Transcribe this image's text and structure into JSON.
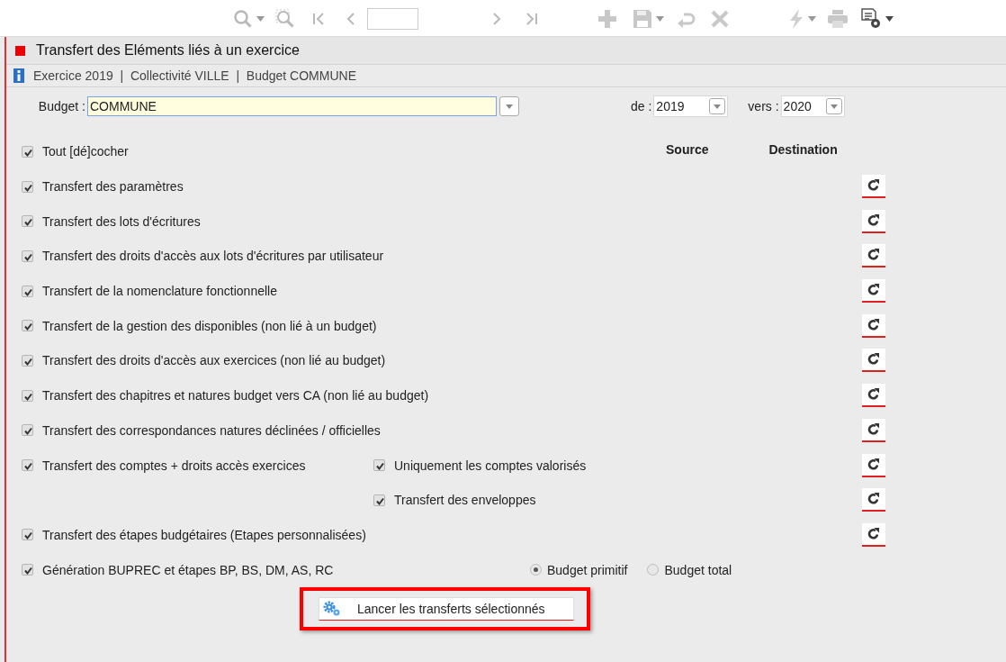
{
  "title": "Transfert des Eléments liés à un exercice",
  "context": "Exercice 2019  |  Collectivité VILLE  |  Budget COMMUNE",
  "budget": {
    "label": "Budget :",
    "value": "COMMUNE"
  },
  "year_from": {
    "label": "de :",
    "value": "2019"
  },
  "year_to": {
    "label": "vers :",
    "value": "2020"
  },
  "toggle_all": {
    "label": "Tout [dé]cocher",
    "checked": true
  },
  "columns": [
    "Source",
    "Destination"
  ],
  "rows": [
    {
      "kind": "transfer",
      "label": "Transfert des paramètres",
      "checked": true
    },
    {
      "kind": "transfer",
      "label": "Transfert des lots d'écritures",
      "checked": true
    },
    {
      "kind": "transfer",
      "label": "Transfert des droits d'accès aux lots d'écritures par utilisateur",
      "checked": true
    },
    {
      "kind": "transfer",
      "label": "Transfert de la nomenclature fonctionnelle",
      "checked": true
    },
    {
      "kind": "transfer",
      "label": "Transfert de la gestion des disponibles (non lié à un budget)",
      "checked": true
    },
    {
      "kind": "transfer",
      "label": "Transfert des droits d'accès aux exercices (non lié au budget)",
      "checked": true
    },
    {
      "kind": "transfer",
      "label": "Transfert des chapitres et natures budget vers CA (non lié au budget)",
      "checked": true
    },
    {
      "kind": "transfer",
      "label": "Transfert des correspondances natures déclinées / officielles",
      "checked": true
    },
    {
      "kind": "transfer",
      "label": "Transfert des comptes + droits accès exercices",
      "checked": true,
      "option": {
        "label": "Uniquement les comptes valorisés",
        "checked": true
      }
    },
    {
      "kind": "option",
      "label": "Transfert des enveloppes",
      "checked": true
    },
    {
      "kind": "transfer",
      "label": "Transfert des étapes budgétaires (Etapes personnalisées)",
      "checked": true
    },
    {
      "kind": "generation",
      "label": "Génération BUPREC et étapes BP, BS, DM, AS, RC",
      "checked": true,
      "choices": [
        {
          "label": "Budget primitif",
          "selected": true
        },
        {
          "label": "Budget total",
          "selected": false
        }
      ]
    }
  ],
  "launch_button": {
    "label": "Lancer les transferts sélectionnés",
    "highlighted": true
  }
}
